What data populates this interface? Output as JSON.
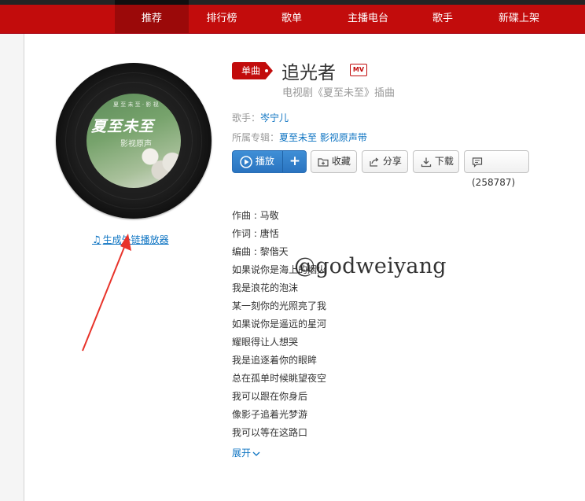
{
  "nav": {
    "items": [
      "推荐",
      "排行榜",
      "歌单",
      "主播电台",
      "歌手",
      "新碟上架"
    ]
  },
  "cover": {
    "title": "夏至未至",
    "subtitle": "影视原声",
    "top_text": "夏 至 未 至 · 影 视"
  },
  "player_link": "生成外链播放器",
  "song": {
    "badge": "单曲",
    "title": "追光者",
    "mv_label": "MV",
    "subtitle": "电视剧《夏至未至》插曲",
    "singer_label": "歌手：",
    "singer": "岑宁儿",
    "album_label": "所属专辑：",
    "album": "夏至未至 影视原声带"
  },
  "actions": {
    "play": "播放",
    "add": "+",
    "collect": "收藏",
    "share": "分享",
    "download": "下载",
    "comments": "(258787)"
  },
  "lyrics": [
    "作曲 : 马敬",
    "作词 : 唐恬",
    "编曲 : 黎偕天",
    "如果说你是海上的烟火",
    "我是浪花的泡沫",
    "某一刻你的光照亮了我",
    "如果说你是遥远的星河",
    "耀眼得让人想哭",
    "我是追逐着你的眼眸",
    "总在孤单时候眺望夜空",
    "我可以跟在你身后",
    "像影子追着光梦游",
    "我可以等在这路口"
  ],
  "expand": "展开",
  "watermark": "@godweiyang",
  "colors": {
    "brand_red": "#c20c0c",
    "link_blue": "#0c73c2",
    "play_blue": "#2a74c0"
  }
}
